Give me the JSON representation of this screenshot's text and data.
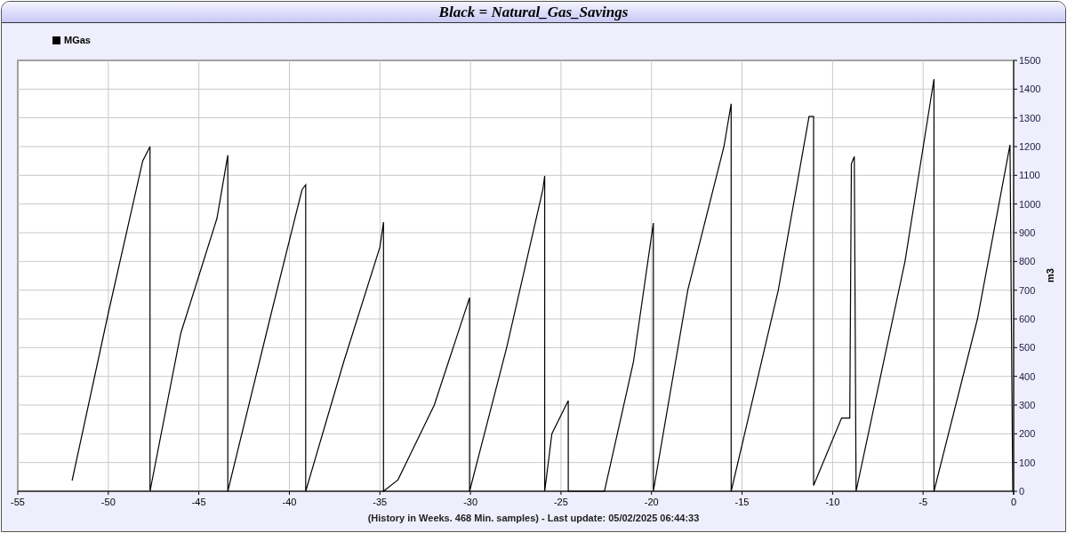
{
  "window": {
    "title": "Black = Natural_Gas_Savings"
  },
  "chart": {
    "caption": "(History in Weeks. 468 Min. samples) - Last update: 05/02/2025 06:44:33",
    "chart_data": {
      "type": "line",
      "ylabel": "m3",
      "grid": true,
      "xlim": [
        -55,
        0
      ],
      "ylim": [
        0,
        1500
      ],
      "xticks": [
        -55,
        -50,
        -45,
        -40,
        -35,
        -30,
        -25,
        -20,
        -15,
        -10,
        -5,
        0
      ],
      "yticks": [
        0,
        100,
        200,
        300,
        400,
        500,
        600,
        700,
        800,
        900,
        1000,
        1100,
        1200,
        1300,
        1400,
        1500
      ],
      "x": [
        -52,
        -50,
        -48.1,
        -47.7,
        -47.7,
        -46,
        -44,
        -43.4,
        -43.4,
        -41,
        -39.3,
        -39.1,
        -39.1,
        -37,
        -35,
        -34.8,
        -34.8,
        -34,
        -32,
        -30.05,
        -30.05,
        -28,
        -26,
        -25.9,
        -25.9,
        -25.5,
        -24.6,
        -24.6,
        -22.6,
        -21,
        -19.9,
        -19.9,
        -18,
        -16,
        -15.6,
        -15.6,
        -13,
        -11.3,
        -11.05,
        -11.05,
        -9.5,
        -9.05,
        -8.96,
        -8.8,
        -8.7,
        -6,
        -4.4,
        -4.4,
        -2,
        -0.2,
        -0.05
      ],
      "series": [
        {
          "name": "MGas",
          "color": "#000000",
          "values": [
            37,
            620,
            1150,
            1200,
            0,
            550,
            950,
            1170,
            0,
            620,
            1050,
            1067,
            0,
            450,
            850,
            937,
            0,
            40,
            300,
            674,
            0,
            500,
            1050,
            1098,
            0,
            200,
            315,
            0,
            0,
            450,
            934,
            0,
            700,
            1200,
            1349,
            0,
            700,
            1305,
            1305,
            20,
            255,
            255,
            1140,
            1165,
            0,
            800,
            1435,
            0,
            600,
            1206,
            0
          ]
        }
      ]
    }
  }
}
